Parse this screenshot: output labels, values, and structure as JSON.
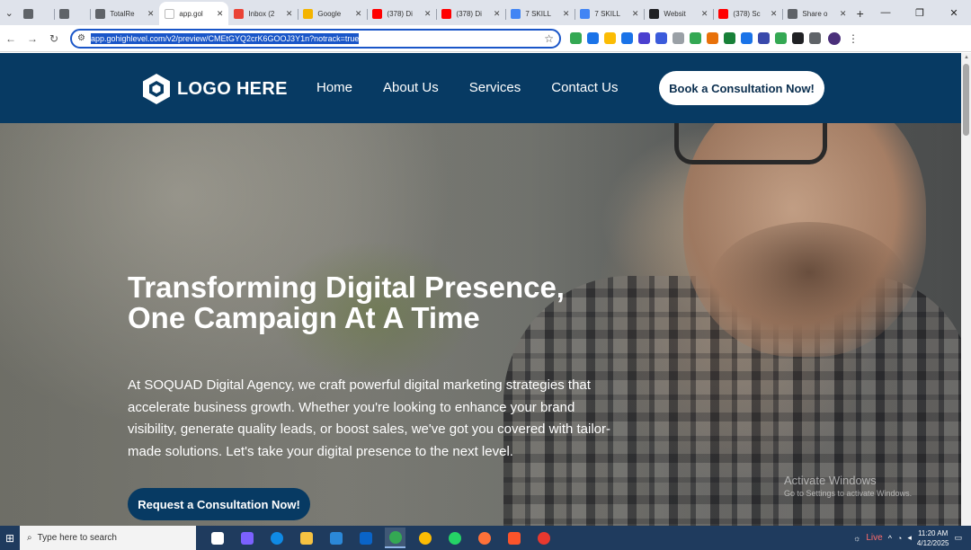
{
  "browser": {
    "tabs": [
      {
        "title": "",
        "favicon_color": "#5f6368",
        "active": false,
        "small": true
      },
      {
        "title": "",
        "favicon_color": "#5f6368",
        "active": false,
        "small": true
      },
      {
        "title": "TotalRe",
        "favicon_color": "#5f6368",
        "active": false
      },
      {
        "title": "app.gol",
        "favicon_color": "#ffffff",
        "active": true
      },
      {
        "title": "Inbox (2",
        "favicon_color": "#ea4335",
        "active": false,
        "icon": "gmail-icon"
      },
      {
        "title": "Google",
        "favicon_color": "#f4b400",
        "active": false
      },
      {
        "title": "(378) Di",
        "favicon_color": "#ff0000",
        "active": false,
        "icon": "youtube-icon"
      },
      {
        "title": "(378) Di",
        "favicon_color": "#ff0000",
        "active": false,
        "icon": "youtube-icon"
      },
      {
        "title": "7 SKILL",
        "favicon_color": "#4285f4",
        "active": false,
        "icon": "docs-icon"
      },
      {
        "title": "7 SKILL",
        "favicon_color": "#4285f4",
        "active": false,
        "icon": "docs-icon"
      },
      {
        "title": "Websit",
        "favicon_color": "#202124",
        "active": false
      },
      {
        "title": "(378) Sc",
        "favicon_color": "#ff0000",
        "active": false,
        "icon": "youtube-icon"
      },
      {
        "title": "Share o",
        "favicon_color": "#5f6368",
        "active": false
      }
    ],
    "new_tab": "+",
    "url": "app.gohighlevel.com/v2/preview/CMEtGYQ2crK6GOOJ3Y1n?notrack=true",
    "extension_colors": [
      "#34a853",
      "#1a73e8",
      "#fbbc04",
      "#1a73e8",
      "#4b3fcf",
      "#3b5bdb",
      "#9aa0a6",
      "#34a853",
      "#e8710a",
      "#188038",
      "#1a73e8",
      "#3949ab",
      "#34a853",
      "#202124",
      "#5f6368"
    ]
  },
  "site": {
    "logo_text": "LOGO HERE",
    "nav": [
      {
        "label": "Home"
      },
      {
        "label": "About Us"
      },
      {
        "label": "Services"
      },
      {
        "label": "Contact Us"
      }
    ],
    "cta_top": "Book a Consultation Now!",
    "hero": {
      "title_line1": "Transforming Digital Presence,",
      "title_line2": "One Campaign At A Time",
      "body": "At SOQUAD Digital Agency, we craft powerful digital marketing strategies that accelerate business growth. Whether you're looking to enhance your brand visibility, generate quality leads, or boost sales, we've got you covered with tailor-made solutions. Let's take your digital presence to the next level.",
      "cta": "Request a Consultation Now!"
    },
    "brand_color": "#073a63"
  },
  "watermark": {
    "line1": "Activate Windows",
    "line2": "Go to Settings to activate Windows."
  },
  "taskbar": {
    "search_placeholder": "Type here to search",
    "apps": [
      {
        "name": "task-view-icon",
        "color": "#ffffff"
      },
      {
        "name": "copilot-icon",
        "color": "#7b61ff"
      },
      {
        "name": "edge-icon",
        "color": "#0f8ae5"
      },
      {
        "name": "file-explorer-icon",
        "color": "#f5c242"
      },
      {
        "name": "store-icon",
        "color": "#2b88d8"
      },
      {
        "name": "outlook-icon",
        "color": "#0a64c8"
      },
      {
        "name": "chrome-icon",
        "color": "#34a853",
        "active": true
      },
      {
        "name": "chrome-alt-icon",
        "color": "#fbbc04"
      },
      {
        "name": "whatsapp-icon",
        "color": "#25d366"
      },
      {
        "name": "firefox-icon",
        "color": "#ff7139"
      },
      {
        "name": "brave-icon",
        "color": "#fb542b"
      },
      {
        "name": "opera-icon",
        "color": "#e8382e"
      }
    ],
    "live_label": "Live",
    "time": "11:20 AM",
    "date": "4/12/2025"
  }
}
